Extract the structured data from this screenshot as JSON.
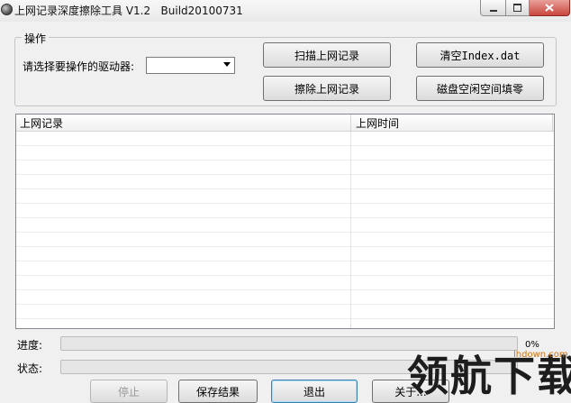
{
  "window": {
    "title": "上网记录深度擦除工具 V1.2   Build20100731",
    "controls": {
      "minimize": "minimize",
      "maximize": "maximize",
      "close": "close"
    }
  },
  "operations": {
    "legend": "操作",
    "drive_label": "请选择要操作的驱动器:",
    "drive_value": "",
    "scan_button": "扫描上网记录",
    "clear_index_button": "清空Index.dat",
    "erase_button": "擦除上网记录",
    "fill_free_button": "磁盘空闲空间填零"
  },
  "list": {
    "columns": [
      "上网记录",
      "上网时间"
    ],
    "rows": []
  },
  "progress": {
    "label": "进度:",
    "percent_text": "0%",
    "value": 0
  },
  "status": {
    "label": "状态:",
    "text": ""
  },
  "footer": {
    "stop_button": "停止",
    "save_button": "保存结果",
    "exit_button": "退出",
    "about_button": "关于..."
  },
  "watermark": {
    "text": "领航下载",
    "url": "lhdown.com"
  },
  "colors": {
    "accent_green": "#37b34a",
    "close_red": "#c9463d",
    "watermark_orange": "#d07010"
  }
}
